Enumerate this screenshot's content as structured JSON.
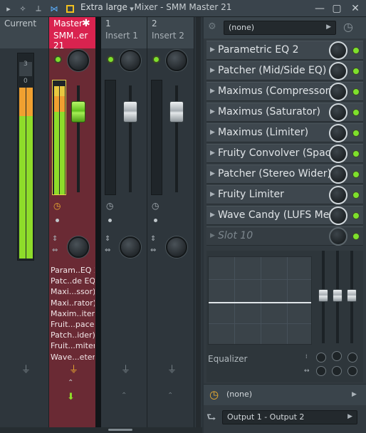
{
  "toolbar": {
    "title": "Extra large",
    "icons": [
      "play-menu-icon",
      "magnet-icon",
      "unlink-icon",
      "stretch-icon",
      "square-icon"
    ]
  },
  "window": {
    "title": "Mixer - SMM Master 21",
    "buttons": [
      "minimize-icon",
      "maximize-icon",
      "close-icon"
    ]
  },
  "strips": [
    {
      "name": "Current",
      "sub": ""
    },
    {
      "name": "Master",
      "sub": "SMM..er 21"
    },
    {
      "name": "1",
      "sub": "Insert 1"
    },
    {
      "name": "2",
      "sub": "Insert 2"
    }
  ],
  "current_meter": {
    "scale_top": "3",
    "scale_mid": "0"
  },
  "master_fx_list": [
    "Param..EQ 2",
    "Patc..de EQ)",
    "Maxi...ssor)",
    "Maxi..rator)",
    "Maxim..iter)",
    "Fruit...pace)",
    "Patch..ider)",
    "Fruit...miter",
    "Wave...eter)"
  ],
  "panel": {
    "preset": "(none)",
    "slots": [
      {
        "label": "Parametric EQ 2",
        "enabled": true
      },
      {
        "label": "Patcher (Mid/Side EQ)",
        "enabled": true
      },
      {
        "label": "Maximus (Compressor)",
        "enabled": true
      },
      {
        "label": "Maximus (Saturator)",
        "enabled": true
      },
      {
        "label": "Maximus (Limiter)",
        "enabled": true
      },
      {
        "label": "Fruity Convolver (Space)",
        "enabled": true
      },
      {
        "label": "Patcher (Stereo Wider)",
        "enabled": true
      },
      {
        "label": "Fruity Limiter",
        "enabled": true
      },
      {
        "label": "Wave Candy (LUFS Mete..",
        "enabled": true
      },
      {
        "label": "Slot 10",
        "enabled": false
      }
    ],
    "eq_label": "Equalizer",
    "send": "(none)",
    "output": "Output 1 - Output 2"
  },
  "colors": {
    "master_accent": "#d9234f",
    "led_green": "#7ee02c",
    "meter_green": "#8edc2a",
    "meter_orange": "#f0a030"
  }
}
